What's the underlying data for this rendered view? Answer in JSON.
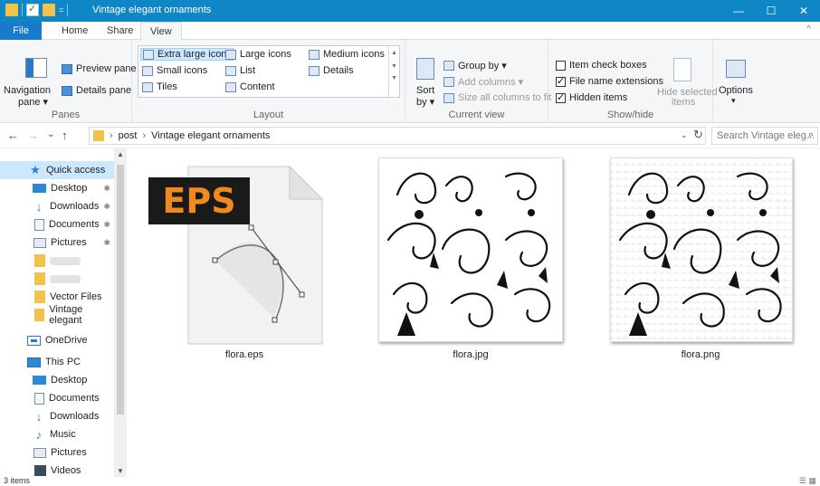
{
  "window": {
    "title": "Vintage elegant ornaments",
    "controls": {
      "minimize": "—",
      "maximize": "☐",
      "close": "✕"
    }
  },
  "ribbon_tabs": {
    "file": "File",
    "home": "Home",
    "share": "Share",
    "view": "View",
    "collapse": "^"
  },
  "ribbon": {
    "panes": {
      "navigation_pane": "Navigation",
      "navigation_pane_2": "pane ▾",
      "preview_pane": "Preview pane",
      "details_pane": "Details pane",
      "label": "Panes"
    },
    "layout": {
      "extra_large_icons": "Extra large icons",
      "large_icons": "Large icons",
      "medium_icons": "Medium icons",
      "small_icons": "Small icons",
      "list": "List",
      "details": "Details",
      "tiles": "Tiles",
      "content": "Content",
      "label": "Layout"
    },
    "current_view": {
      "sort_by": "Sort",
      "sort_by_2": "by ▾",
      "group_by": "Group by ▾",
      "add_columns": "Add columns ▾",
      "size_all_columns": "Size all columns to fit",
      "label": "Current view"
    },
    "show_hide": {
      "item_check_boxes": "Item check boxes",
      "item_check_boxes_checked": false,
      "file_name_extensions": "File name extensions",
      "file_name_extensions_checked": true,
      "hidden_items": "Hidden items",
      "hidden_items_checked": true,
      "hide_selected": "Hide selected",
      "hide_selected_2": "items",
      "label": "Show/hide"
    },
    "options": {
      "label": "Options",
      "arrow": "▾"
    }
  },
  "address_bar": {
    "back": "←",
    "forward": "→",
    "recent": "⌄",
    "up": "↑",
    "crumbs": [
      "post",
      "Vintage elegant ornaments"
    ],
    "separator": "›",
    "dropdown": "⌄",
    "refresh": "↻",
    "search_placeholder": "Search Vintage eleg...",
    "search_icon": "⌕"
  },
  "nav_pane": {
    "items": [
      {
        "label": "Quick access",
        "icon": "star-icon",
        "selected": true
      },
      {
        "label": "Desktop",
        "icon": "desktop-icon",
        "pinned": true
      },
      {
        "label": "Downloads",
        "icon": "download-icon",
        "pinned": true
      },
      {
        "label": "Documents",
        "icon": "documents-icon",
        "pinned": true
      },
      {
        "label": "Pictures",
        "icon": "pictures-icon",
        "pinned": true
      },
      {
        "label": "",
        "icon": "folder-icon"
      },
      {
        "label": "",
        "icon": "folder-icon"
      },
      {
        "label": "Vector Files",
        "icon": "folder-icon"
      },
      {
        "label": "Vintage elegant",
        "icon": "folder-icon"
      },
      {
        "label": "OneDrive",
        "icon": "onedrive-icon"
      },
      {
        "label": "This PC",
        "icon": "pc-icon"
      },
      {
        "label": "Desktop",
        "icon": "desktop-icon"
      },
      {
        "label": "Documents",
        "icon": "documents-icon"
      },
      {
        "label": "Downloads",
        "icon": "download-icon"
      },
      {
        "label": "Music",
        "icon": "music-icon"
      },
      {
        "label": "Pictures",
        "icon": "pictures-icon"
      },
      {
        "label": "Videos",
        "icon": "videos-icon"
      }
    ],
    "pin_glyph": "📌"
  },
  "files": [
    {
      "name": "flora.eps",
      "badge": "EPS"
    },
    {
      "name": "flora.jpg"
    },
    {
      "name": "flora.png"
    }
  ],
  "status": {
    "count": "3 items"
  },
  "colors": {
    "titlebar": "#0f86c6",
    "file_tab": "#1979ca",
    "selection": "#cce8ff",
    "eps_badge_text": "#f08a1c"
  }
}
